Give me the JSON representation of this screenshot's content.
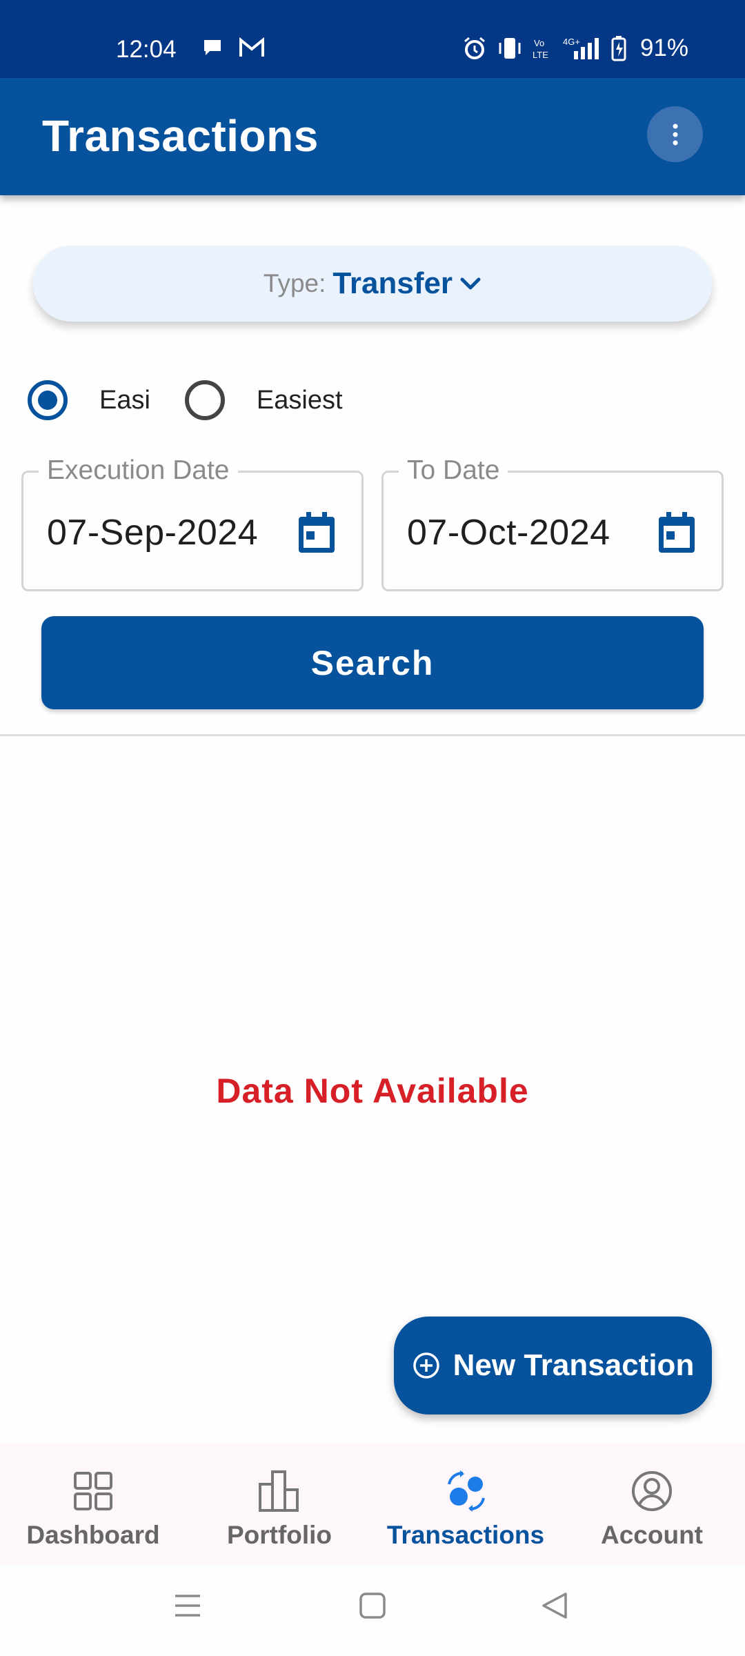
{
  "status_bar": {
    "time": "12:04",
    "battery": "91%",
    "network": "4G+"
  },
  "app_bar": {
    "title": "Transactions"
  },
  "filter": {
    "type_label": "Type:",
    "type_value": "Transfer"
  },
  "radios": [
    {
      "label": "Easi",
      "checked": true
    },
    {
      "label": "Easiest",
      "checked": false
    }
  ],
  "dates": {
    "from_label": "Execution Date",
    "from_value": "07-Sep-2024",
    "to_label": "To Date",
    "to_value": "07-Oct-2024"
  },
  "search_label": "Search",
  "empty_message": "Data Not Available",
  "fab_label": "New Transaction",
  "bottom_nav": [
    {
      "label": "Dashboard",
      "icon": "dashboard-icon",
      "active": false
    },
    {
      "label": "Portfolio",
      "icon": "portfolio-icon",
      "active": false
    },
    {
      "label": "Transactions",
      "icon": "transactions-icon",
      "active": true
    },
    {
      "label": "Account",
      "icon": "account-icon",
      "active": false
    }
  ],
  "colors": {
    "primary": "#07529d",
    "status_bar": "#043886",
    "error": "#d61f26",
    "pill_bg": "#eaf3fd",
    "accent_icon": "#1e7ce8"
  }
}
